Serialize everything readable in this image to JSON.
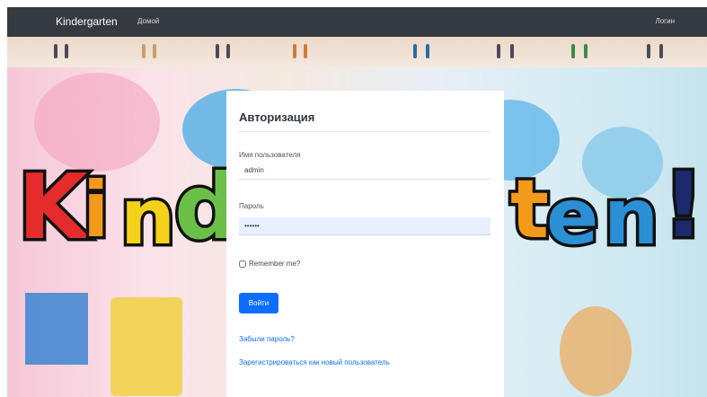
{
  "navbar": {
    "brand": "Kindergarten",
    "home_label": "Домой",
    "login_label": "Логин"
  },
  "banner": {
    "letters": [
      "K",
      "i",
      "n",
      "d",
      "t",
      "e",
      "n",
      "!"
    ],
    "colors": [
      "#e52b2b",
      "#f39a1b",
      "#f4d21c",
      "#6cc04a",
      "#f39a1b",
      "#2b8fd6",
      "#2b8fd6",
      "#1a2a6c"
    ]
  },
  "login": {
    "title": "Авторизация",
    "username_label": "Имя пользователя",
    "username_value": "admin",
    "password_label": "Пароль",
    "password_value": "••••••",
    "remember_label": "Remember me?",
    "submit_label": "Войти",
    "forgot_link": "Забыли пароль?",
    "register_link": "Зарегистрироваться как новый пользователь"
  }
}
